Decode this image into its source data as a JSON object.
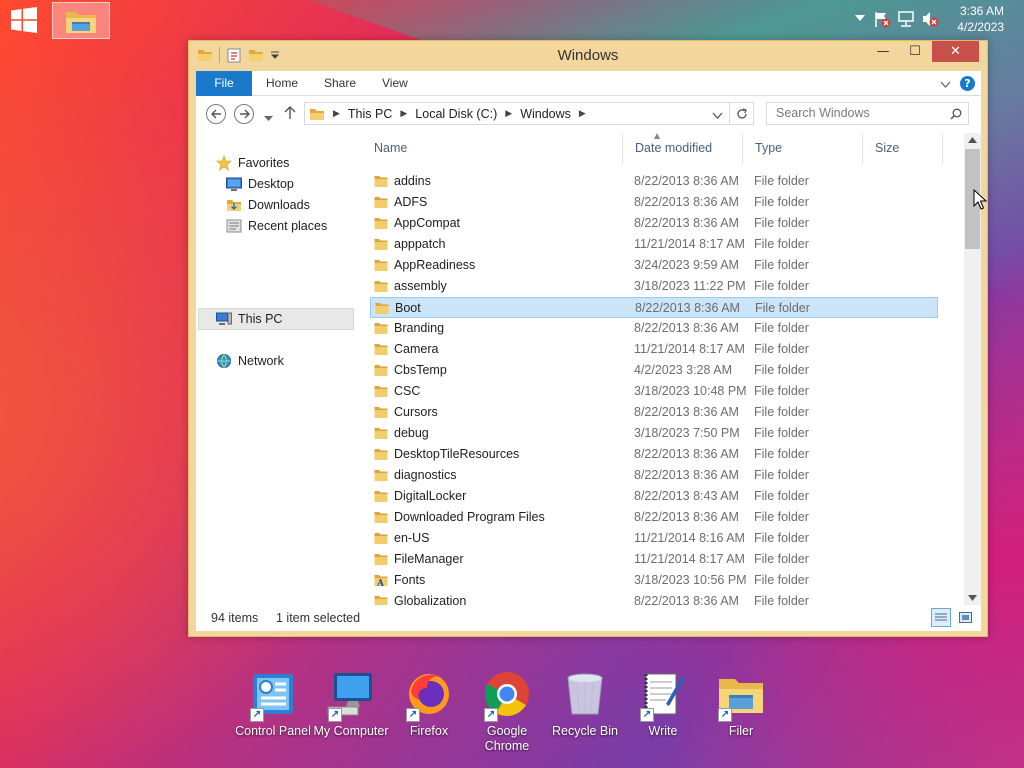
{
  "taskbar": {
    "start_icon": "windows-logo-icon",
    "pinned_app_icon": "file-explorer-icon",
    "tray_icons": [
      "chevron-up-icon",
      "action-center-flag-icon",
      "network-icon",
      "volume-muted-icon"
    ],
    "time": "3:36 AM",
    "date": "4/2/2023"
  },
  "window": {
    "title": "Windows",
    "minimize": "—",
    "maximize": "☐",
    "close": "✕"
  },
  "ribbon": {
    "tabs": [
      "File",
      "Home",
      "Share",
      "View"
    ],
    "help": "?"
  },
  "address": {
    "crumbs": [
      "This PC",
      "Local Disk (C:)",
      "Windows"
    ],
    "search_placeholder": "Search Windows"
  },
  "nav": {
    "favorites": "Favorites",
    "desktop": "Desktop",
    "downloads": "Downloads",
    "recent": "Recent places",
    "this_pc": "This PC",
    "network": "Network"
  },
  "columns": {
    "name": "Name",
    "date": "Date modified",
    "type": "Type",
    "size": "Size"
  },
  "files": [
    {
      "name": "addins",
      "date": "8/22/2013 8:36 AM",
      "type": "File folder"
    },
    {
      "name": "ADFS",
      "date": "8/22/2013 8:36 AM",
      "type": "File folder"
    },
    {
      "name": "AppCompat",
      "date": "8/22/2013 8:36 AM",
      "type": "File folder"
    },
    {
      "name": "apppatch",
      "date": "11/21/2014 8:17 AM",
      "type": "File folder"
    },
    {
      "name": "AppReadiness",
      "date": "3/24/2023 9:59 AM",
      "type": "File folder"
    },
    {
      "name": "assembly",
      "date": "3/18/2023 11:22 PM",
      "type": "File folder"
    },
    {
      "name": "Boot",
      "date": "8/22/2013 8:36 AM",
      "type": "File folder",
      "selected": true
    },
    {
      "name": "Branding",
      "date": "8/22/2013 8:36 AM",
      "type": "File folder"
    },
    {
      "name": "Camera",
      "date": "11/21/2014 8:17 AM",
      "type": "File folder"
    },
    {
      "name": "CbsTemp",
      "date": "4/2/2023 3:28 AM",
      "type": "File folder"
    },
    {
      "name": "CSC",
      "date": "3/18/2023 10:48 PM",
      "type": "File folder"
    },
    {
      "name": "Cursors",
      "date": "8/22/2013 8:36 AM",
      "type": "File folder"
    },
    {
      "name": "debug",
      "date": "3/18/2023 7:50 PM",
      "type": "File folder"
    },
    {
      "name": "DesktopTileResources",
      "date": "8/22/2013 8:36 AM",
      "type": "File folder"
    },
    {
      "name": "diagnostics",
      "date": "8/22/2013 8:36 AM",
      "type": "File folder"
    },
    {
      "name": "DigitalLocker",
      "date": "8/22/2013 8:43 AM",
      "type": "File folder"
    },
    {
      "name": "Downloaded Program Files",
      "date": "8/22/2013 8:36 AM",
      "type": "File folder"
    },
    {
      "name": "en-US",
      "date": "11/21/2014 8:16 AM",
      "type": "File folder"
    },
    {
      "name": "FileManager",
      "date": "11/21/2014 8:17 AM",
      "type": "File folder"
    },
    {
      "name": "Fonts",
      "date": "3/18/2023 10:56 PM",
      "type": "File folder",
      "icon": "fonts-folder-icon"
    },
    {
      "name": "Globalization",
      "date": "8/22/2013 8:36 AM",
      "type": "File folder"
    }
  ],
  "status": {
    "items": "94 items",
    "selected": "1 item selected"
  },
  "desktop": {
    "icons": [
      "Control Panel",
      "My Computer",
      "Firefox",
      "Google Chrome",
      "Recycle Bin",
      "Write",
      "Filer"
    ]
  },
  "colors": {
    "accent": "#1979ca",
    "window_frame": "#f3d69c",
    "selection": "#cce4f7",
    "close_button": "#c7504a"
  }
}
